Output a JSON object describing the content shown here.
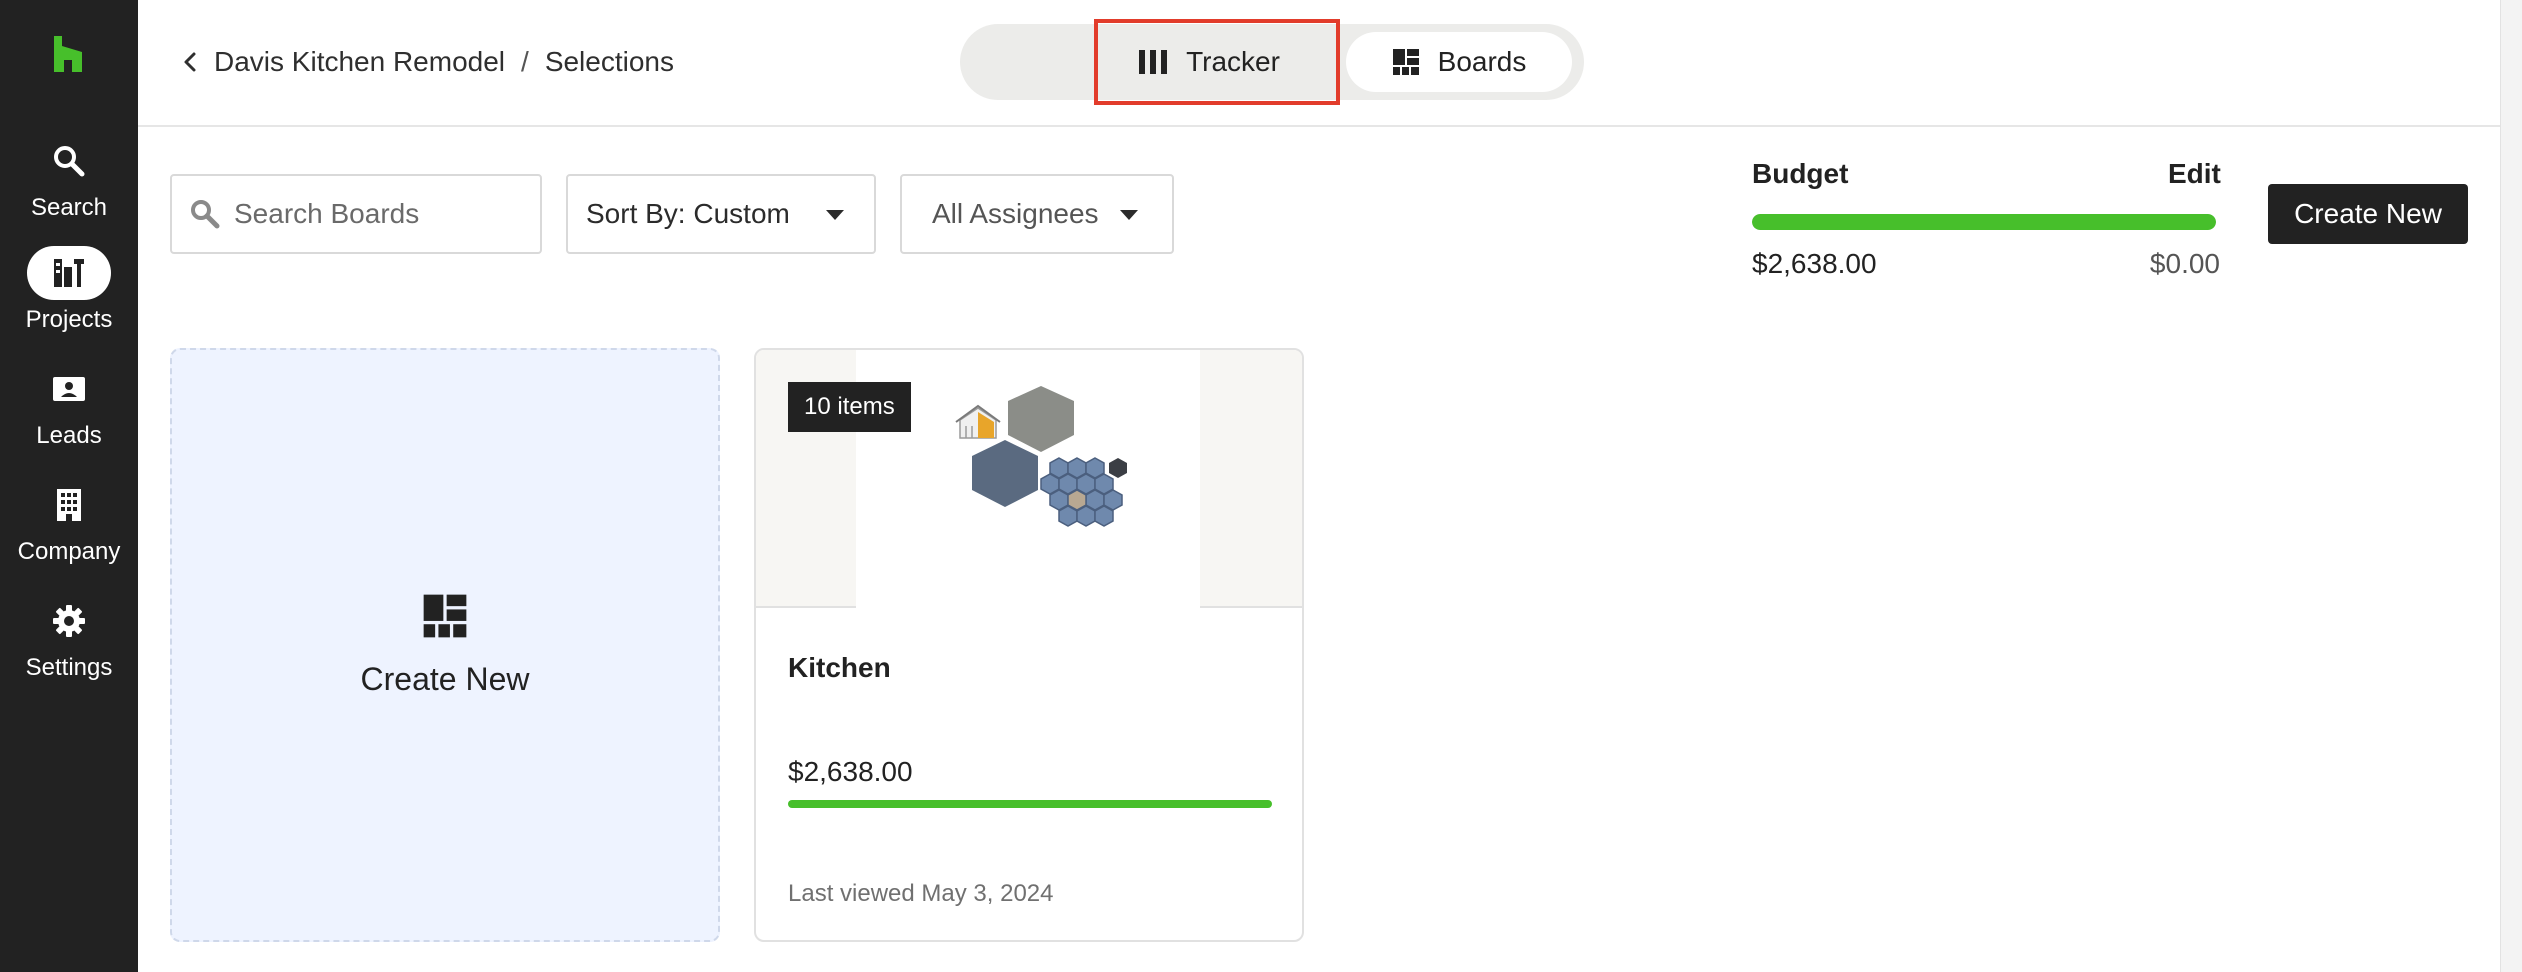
{
  "sidebar": {
    "logo_color": "#47bf2b",
    "items": [
      {
        "label": "Search",
        "icon": "search-icon",
        "active": false
      },
      {
        "label": "Projects",
        "icon": "projects-icon",
        "active": true
      },
      {
        "label": "Leads",
        "icon": "leads-icon",
        "active": false
      },
      {
        "label": "Company",
        "icon": "company-icon",
        "active": false
      },
      {
        "label": "Settings",
        "icon": "settings-icon",
        "active": false
      }
    ]
  },
  "header": {
    "breadcrumb": {
      "project": "Davis Kitchen Remodel",
      "separator": "/",
      "current": "Selections"
    },
    "view_toggle": {
      "tracker_label": "Tracker",
      "boards_label": "Boards",
      "selected": "Boards",
      "highlighted": "Tracker"
    }
  },
  "toolbar": {
    "search_placeholder": "Search Boards",
    "sort_label": "Sort By: Custom",
    "assignees_label": "All Assignees"
  },
  "budget": {
    "label": "Budget",
    "edit_label": "Edit",
    "spent": "$2,638.00",
    "remaining": "$0.00",
    "fill_fraction": 1.0,
    "bar_color": "#47bf2b"
  },
  "create_new_button": "Create New",
  "cards": {
    "create_label": "Create New",
    "board": {
      "items_badge": "10 items",
      "title": "Kitchen",
      "amount": "$2,638.00",
      "fill_fraction": 1.0,
      "last_viewed": "Last viewed May 3, 2024"
    }
  },
  "colors": {
    "sidebar_bg": "#222222",
    "accent_green": "#47bf2b",
    "highlight_red": "#e23c2b",
    "create_card_bg": "#eef3ff"
  }
}
